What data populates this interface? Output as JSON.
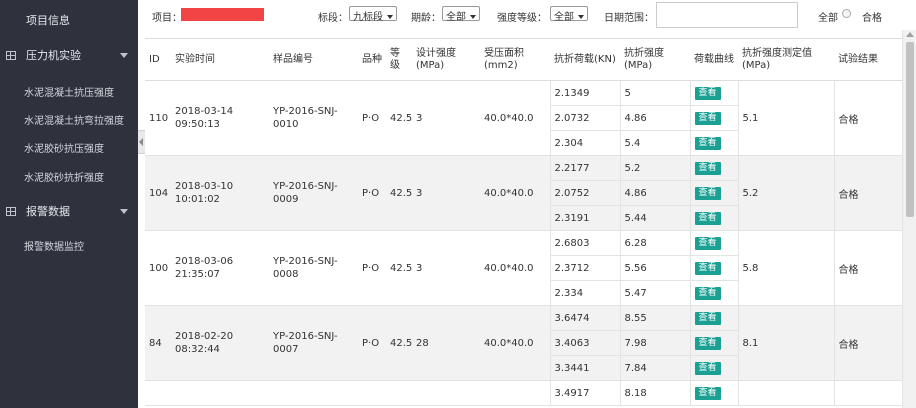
{
  "sidebar": {
    "top_item": "项目信息",
    "groups": [
      {
        "label": "压力机实验",
        "items": [
          "水泥混凝土抗压强度",
          "水泥混凝土抗弯拉强度",
          "水泥胶砂抗压强度",
          "水泥胶砂抗折强度"
        ]
      },
      {
        "label": "报警数据",
        "items": [
          "报警数据监控"
        ]
      }
    ]
  },
  "filters": {
    "project_label": "项目：",
    "section_label": "标段：",
    "section_value": "九标段",
    "period_label": "期龄：",
    "period_value": "全部",
    "grade_label": "强度等级：",
    "grade_value": "全部",
    "date_label": "日期范围：",
    "date_value": "",
    "all_label": "全部",
    "pass_label": "合格"
  },
  "table": {
    "headers": [
      "ID",
      "实验时间",
      "样品编号",
      "品种",
      "等级",
      "设计强度(MPa)",
      "受压面积(mm2)",
      "抗折荷载(KN)",
      "抗折强度(MPa)",
      "荷载曲线",
      "抗折强度测定值(MPa)",
      "试验结果"
    ],
    "view_label": "查看",
    "records": [
      {
        "id": "110",
        "time": "2018-03-14 09:50:13",
        "sample": "YP-2016-SNJ-0010",
        "variety": "P·O",
        "grade": "42.5",
        "design": "3",
        "area": "40.0*40.0",
        "loads": [
          "2.1349",
          "2.0732",
          "2.304"
        ],
        "strengths": [
          "5",
          "4.86",
          "5.4"
        ],
        "measured": "5.1",
        "result": "合格"
      },
      {
        "id": "104",
        "time": "2018-03-10 10:01:02",
        "sample": "YP-2016-SNJ-0009",
        "variety": "P·O",
        "grade": "42.5",
        "design": "3",
        "area": "40.0*40.0",
        "loads": [
          "2.2177",
          "2.0752",
          "2.3191"
        ],
        "strengths": [
          "5.2",
          "4.86",
          "5.44"
        ],
        "measured": "5.2",
        "result": "合格"
      },
      {
        "id": "100",
        "time": "2018-03-06 21:35:07",
        "sample": "YP-2016-SNJ-0008",
        "variety": "P·O",
        "grade": "42.5",
        "design": "3",
        "area": "40.0*40.0",
        "loads": [
          "2.6803",
          "2.3712",
          "2.334"
        ],
        "strengths": [
          "6.28",
          "5.56",
          "5.47"
        ],
        "measured": "5.8",
        "result": "合格"
      },
      {
        "id": "84",
        "time": "2018-02-20 08:32:44",
        "sample": "YP-2016-SNJ-0007",
        "variety": "P·O",
        "grade": "42.5",
        "design": "28",
        "area": "40.0*40.0",
        "loads": [
          "3.6474",
          "3.4063",
          "3.3441"
        ],
        "strengths": [
          "8.55",
          "7.98",
          "7.84"
        ],
        "measured": "8.1",
        "result": "合格"
      },
      {
        "id": "",
        "time": "",
        "sample": "",
        "variety": "",
        "grade": "",
        "design": "",
        "area": "",
        "loads": [
          "3.4917"
        ],
        "strengths": [
          "8.18"
        ],
        "measured": "",
        "result": ""
      }
    ]
  },
  "colors": {
    "sidebar_bg": "#2f323d",
    "accent_button": "#1aa194",
    "redacted": "#f24444",
    "alt_row": "#f2f2f2"
  }
}
